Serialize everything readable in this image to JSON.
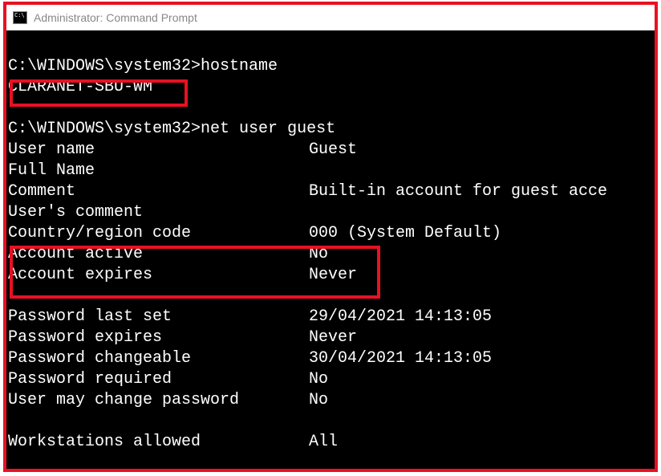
{
  "window": {
    "title": "Administrator: Command Prompt"
  },
  "terminal": {
    "prompt1": "C:\\WINDOWS\\system32>",
    "cmd1": "hostname",
    "hostname": "CLARANET-SBU-WM",
    "prompt2": "C:\\WINDOWS\\system32>",
    "cmd2": "net user guest",
    "fields": {
      "user_name": {
        "label": "User name",
        "value": "Guest"
      },
      "full_name": {
        "label": "Full Name",
        "value": ""
      },
      "comment": {
        "label": "Comment",
        "value": "Built-in account for guest acce"
      },
      "users_comment": {
        "label": "User's comment",
        "value": ""
      },
      "country_region": {
        "label": "Country/region code",
        "value": "000 (System Default)"
      },
      "account_active": {
        "label": "Account active",
        "value": "No"
      },
      "account_expires": {
        "label": "Account expires",
        "value": "Never"
      },
      "pwd_last_set": {
        "label": "Password last set",
        "value": "29/04/2021 14:13:05"
      },
      "pwd_expires": {
        "label": "Password expires",
        "value": "Never"
      },
      "pwd_changeable": {
        "label": "Password changeable",
        "value": "30/04/2021 14:13:05"
      },
      "pwd_required": {
        "label": "Password required",
        "value": "No"
      },
      "user_may_change": {
        "label": "User may change password",
        "value": "No"
      },
      "workstations": {
        "label": "Workstations allowed",
        "value": "All"
      }
    }
  }
}
